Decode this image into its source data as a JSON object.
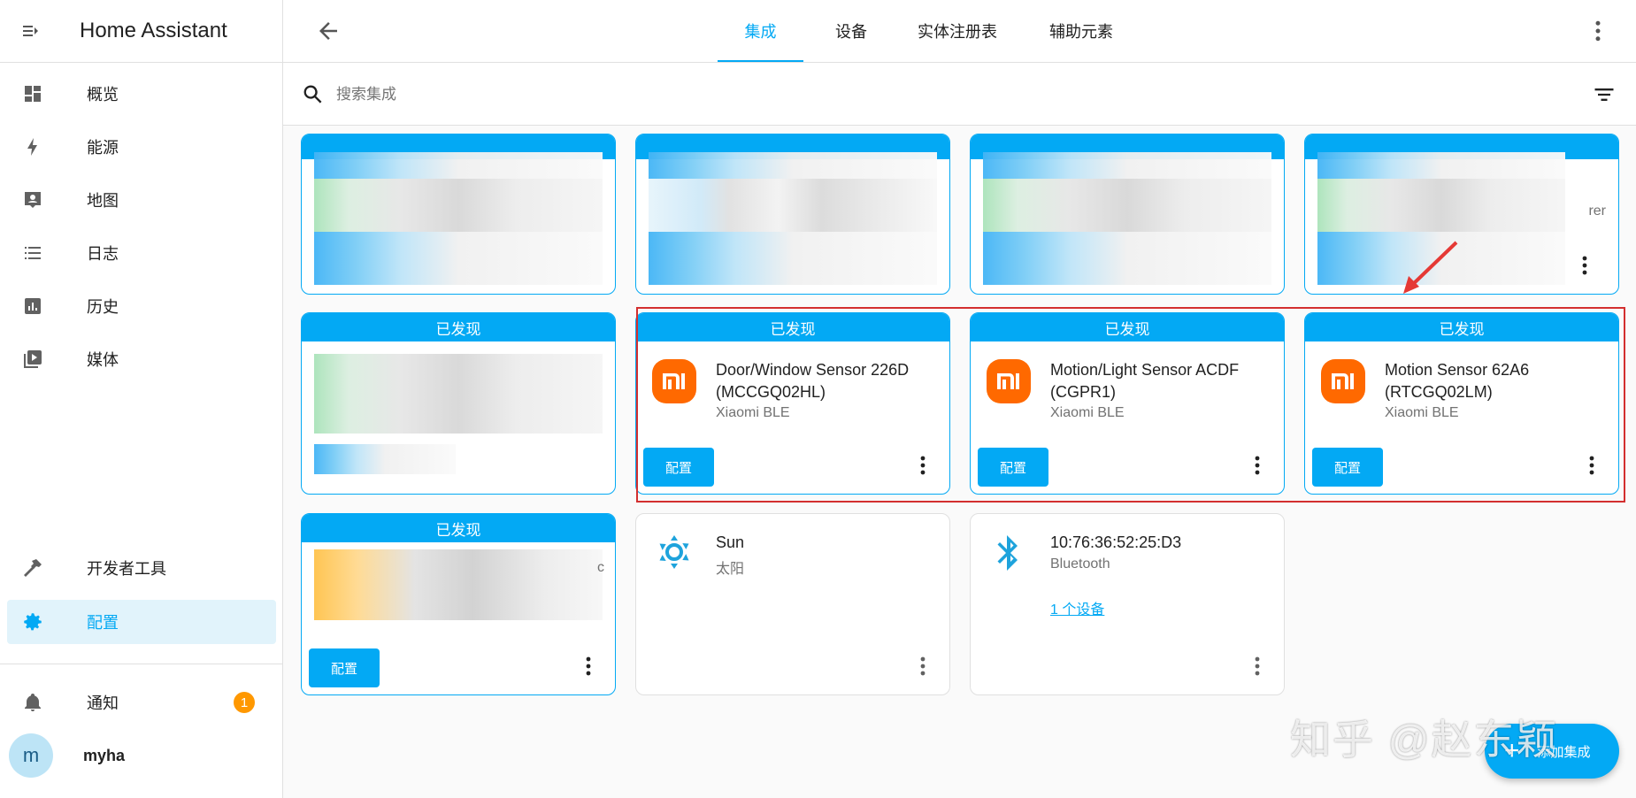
{
  "app": {
    "title": "Home Assistant"
  },
  "sidebar": {
    "items": [
      {
        "label": "概览",
        "icon": "dashboard-icon"
      },
      {
        "label": "能源",
        "icon": "lightning-icon"
      },
      {
        "label": "地图",
        "icon": "map-account-icon"
      },
      {
        "label": "日志",
        "icon": "list-icon"
      },
      {
        "label": "历史",
        "icon": "chart-box-icon"
      },
      {
        "label": "媒体",
        "icon": "play-box-icon"
      }
    ],
    "bottom_items": [
      {
        "label": "开发者工具",
        "icon": "hammer-icon"
      },
      {
        "label": "配置",
        "icon": "gear-icon",
        "active": true
      }
    ],
    "notifications": {
      "label": "通知",
      "count": "1"
    },
    "user": {
      "initial": "m",
      "name": "myha"
    }
  },
  "tabs": [
    "集成",
    "设备",
    "实体注册表",
    "辅助元素"
  ],
  "active_tab": "集成",
  "search": {
    "placeholder": "搜索集成",
    "value": ""
  },
  "cards": {
    "discovered_label": "已发现",
    "configure_label": "配置",
    "xiaomi": [
      {
        "title": "Door/Window Sensor 226D (MCCGQ02HL)",
        "subtitle": "Xiaomi BLE"
      },
      {
        "title": "Motion/Light Sensor ACDF (CGPR1)",
        "subtitle": "Xiaomi BLE"
      },
      {
        "title": "Motion Sensor 62A6 (RTCGQ02LM)",
        "subtitle": "Xiaomi BLE"
      }
    ],
    "blurred_partial_text": {
      "row1": "rer",
      "row3": "c"
    },
    "sun": {
      "title": "Sun",
      "subtitle": "太阳"
    },
    "bluetooth": {
      "title": "10:76:36:52:25:D3",
      "subtitle": "Bluetooth",
      "link": "1 个设备"
    }
  },
  "fab": {
    "label": "添加集成"
  },
  "watermark": "知乎 @赵东颖",
  "colors": {
    "accent": "#03a9f4",
    "highlight": "#d32f2f",
    "xiaomi": "#ff6900",
    "badge": "#ff9800"
  }
}
